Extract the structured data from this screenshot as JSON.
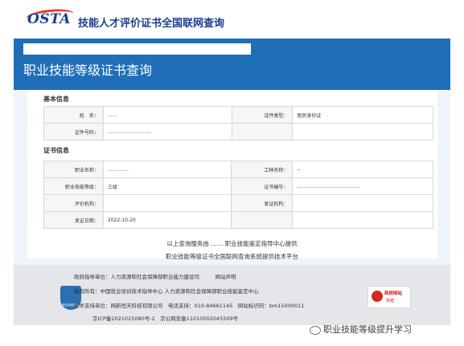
{
  "header": {
    "logo_text": "OSTA",
    "title": "技能人才评价证书全国联网查询"
  },
  "banner": {
    "title": "职业技能等级证书查询"
  },
  "basic_info": {
    "heading": "基本信息",
    "rows": [
      {
        "label": "姓　名：",
        "value": "……",
        "label2": "证件类型：",
        "value2": "居民身份证"
      },
      {
        "label": "证件号码：",
        "value": "………………………",
        "label2": "",
        "value2": ""
      }
    ]
  },
  "cert_info": {
    "heading": "证书信息",
    "rows": [
      {
        "label": "职业名称：",
        "value": "…… ……",
        "label2": "工种名称：",
        "value2": "--"
      },
      {
        "label": "职业技能等级：",
        "value": "三级",
        "label2": "证书编号：",
        "value2": "…………………………………"
      },
      {
        "label": "评价机构：",
        "value": "",
        "label2": "发证机构：",
        "value2": ""
      },
      {
        "label": "发证日期：",
        "value": "2022-10-20",
        "label2": "",
        "value2": ""
      }
    ]
  },
  "footnote": {
    "line1": "以上查询服务由 …… 职业技能鉴定指导中心提供",
    "line2": "职业技能等级证书全国联网查询系统提供技术平台"
  },
  "footer": {
    "badge_label": "职业技能鉴定",
    "lines": [
      "政府指导单位：人力资源和社会保障部职业能力建设司　　　网站声明",
      "版权所有：中国就业培训技术指导中心 人力资源和社会保障部职业技能鉴定中心",
      "技术支持单位：网新恒天科技有限公司　电话支持：010-84661145　网站标识码：bm15000011",
      "京ICP备2021025080号-2　京公网安备11010502045509号"
    ],
    "gov_box": {
      "line1": "政府网站",
      "line2": "找错"
    }
  },
  "watermark": "职业技能等级提升学习"
}
